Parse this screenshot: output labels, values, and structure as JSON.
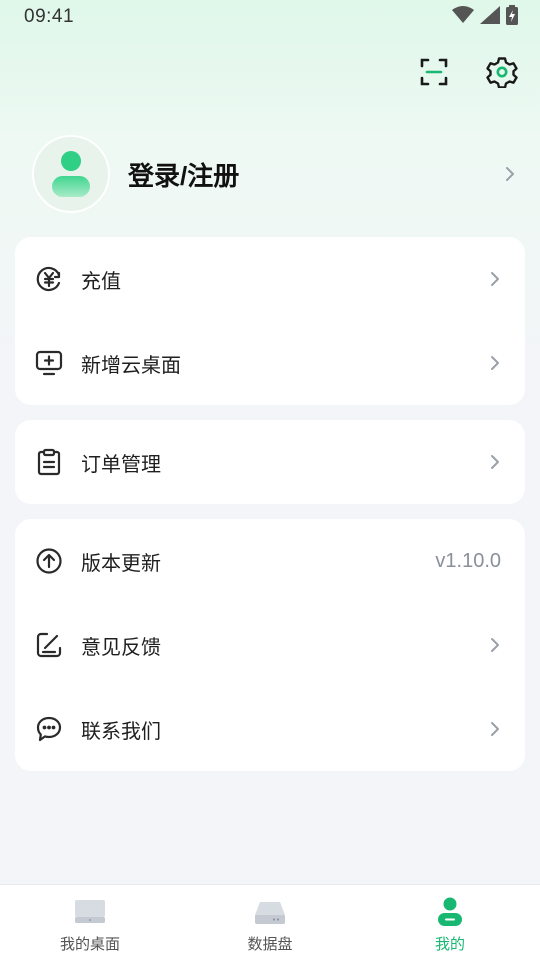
{
  "status_bar": {
    "time": "09:41"
  },
  "profile": {
    "name": "登录/注册"
  },
  "cards": [
    {
      "items": [
        {
          "label": "充值"
        },
        {
          "label": "新增云桌面"
        }
      ]
    },
    {
      "items": [
        {
          "label": "订单管理"
        }
      ]
    },
    {
      "items": [
        {
          "label": "版本更新",
          "value": "v1.10.0"
        },
        {
          "label": "意见反馈"
        },
        {
          "label": "联系我们"
        }
      ]
    }
  ],
  "bottom_nav": {
    "items": [
      {
        "label": "我的桌面"
      },
      {
        "label": "数据盘"
      },
      {
        "label": "我的"
      }
    ]
  },
  "colors": {
    "accent": "#18b873",
    "background": "#f3f5f8"
  }
}
